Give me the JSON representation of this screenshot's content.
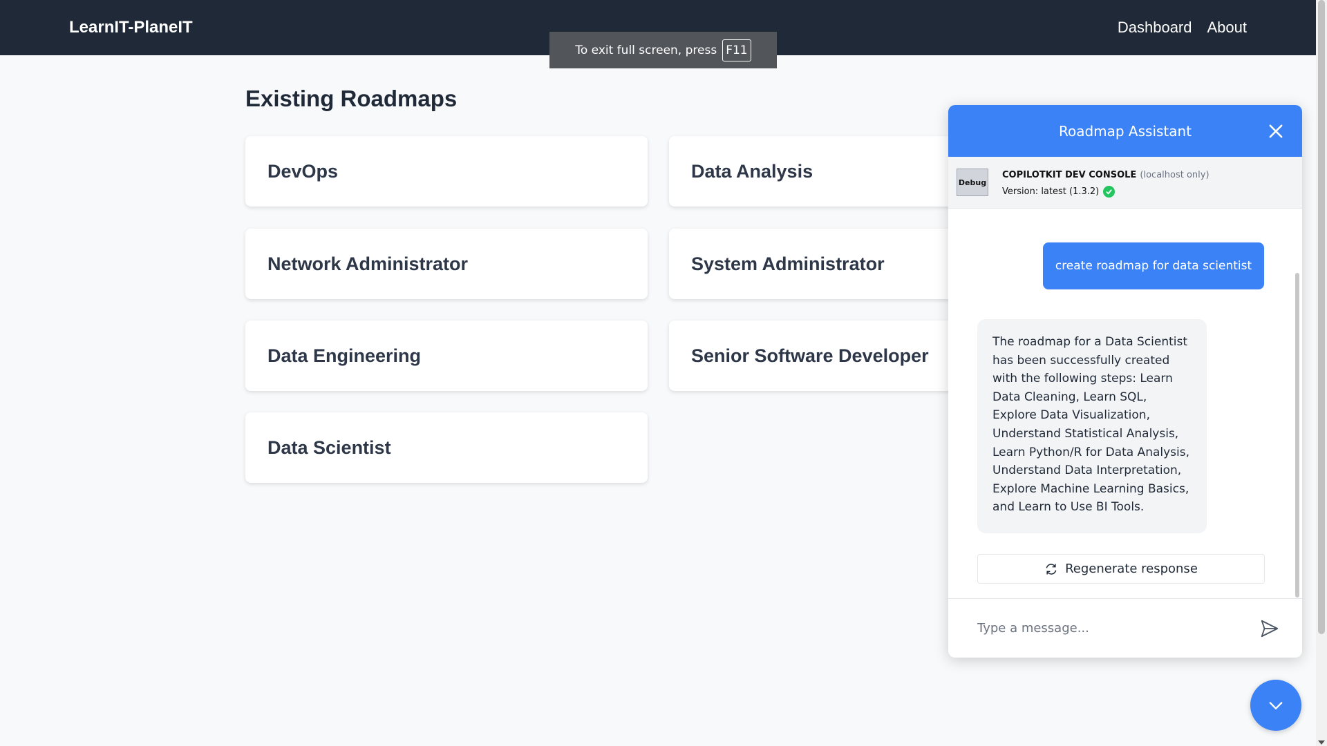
{
  "navbar": {
    "brand": "LearnIT-PlaneIT",
    "links": [
      "Dashboard",
      "About"
    ]
  },
  "fullscreen_toast": {
    "text": "To exit full screen, press",
    "key": "F11"
  },
  "main": {
    "title": "Existing Roadmaps",
    "roadmaps": [
      "DevOps",
      "Data Analysis",
      "Network Administrator",
      "System Administrator",
      "Data Engineering",
      "Senior Software Developer",
      "Data Scientist"
    ]
  },
  "chat": {
    "title": "Roadmap Assistant",
    "dev_console": {
      "badge": "Debug",
      "title": "COPILOTKIT DEV CONSOLE",
      "subtitle": "(localhost only)",
      "version": "Version: latest (1.3.2)"
    },
    "messages": {
      "user": "create roadmap for data scientist",
      "assistant": "The roadmap for a Data Scientist has been successfully created with the following steps: Learn Data Cleaning, Learn SQL, Explore Data Visualization, Understand Statistical Analysis, Learn Python/R for Data Analysis, Understand Data Interpretation, Explore Machine Learning Basics, and Learn to Use BI Tools."
    },
    "regenerate_label": "Regenerate response",
    "input_placeholder": "Type a message..."
  },
  "colors": {
    "navbar_bg": "#1f2937",
    "accent": "#3b82f6",
    "page_bg": "#f8f9fa"
  }
}
